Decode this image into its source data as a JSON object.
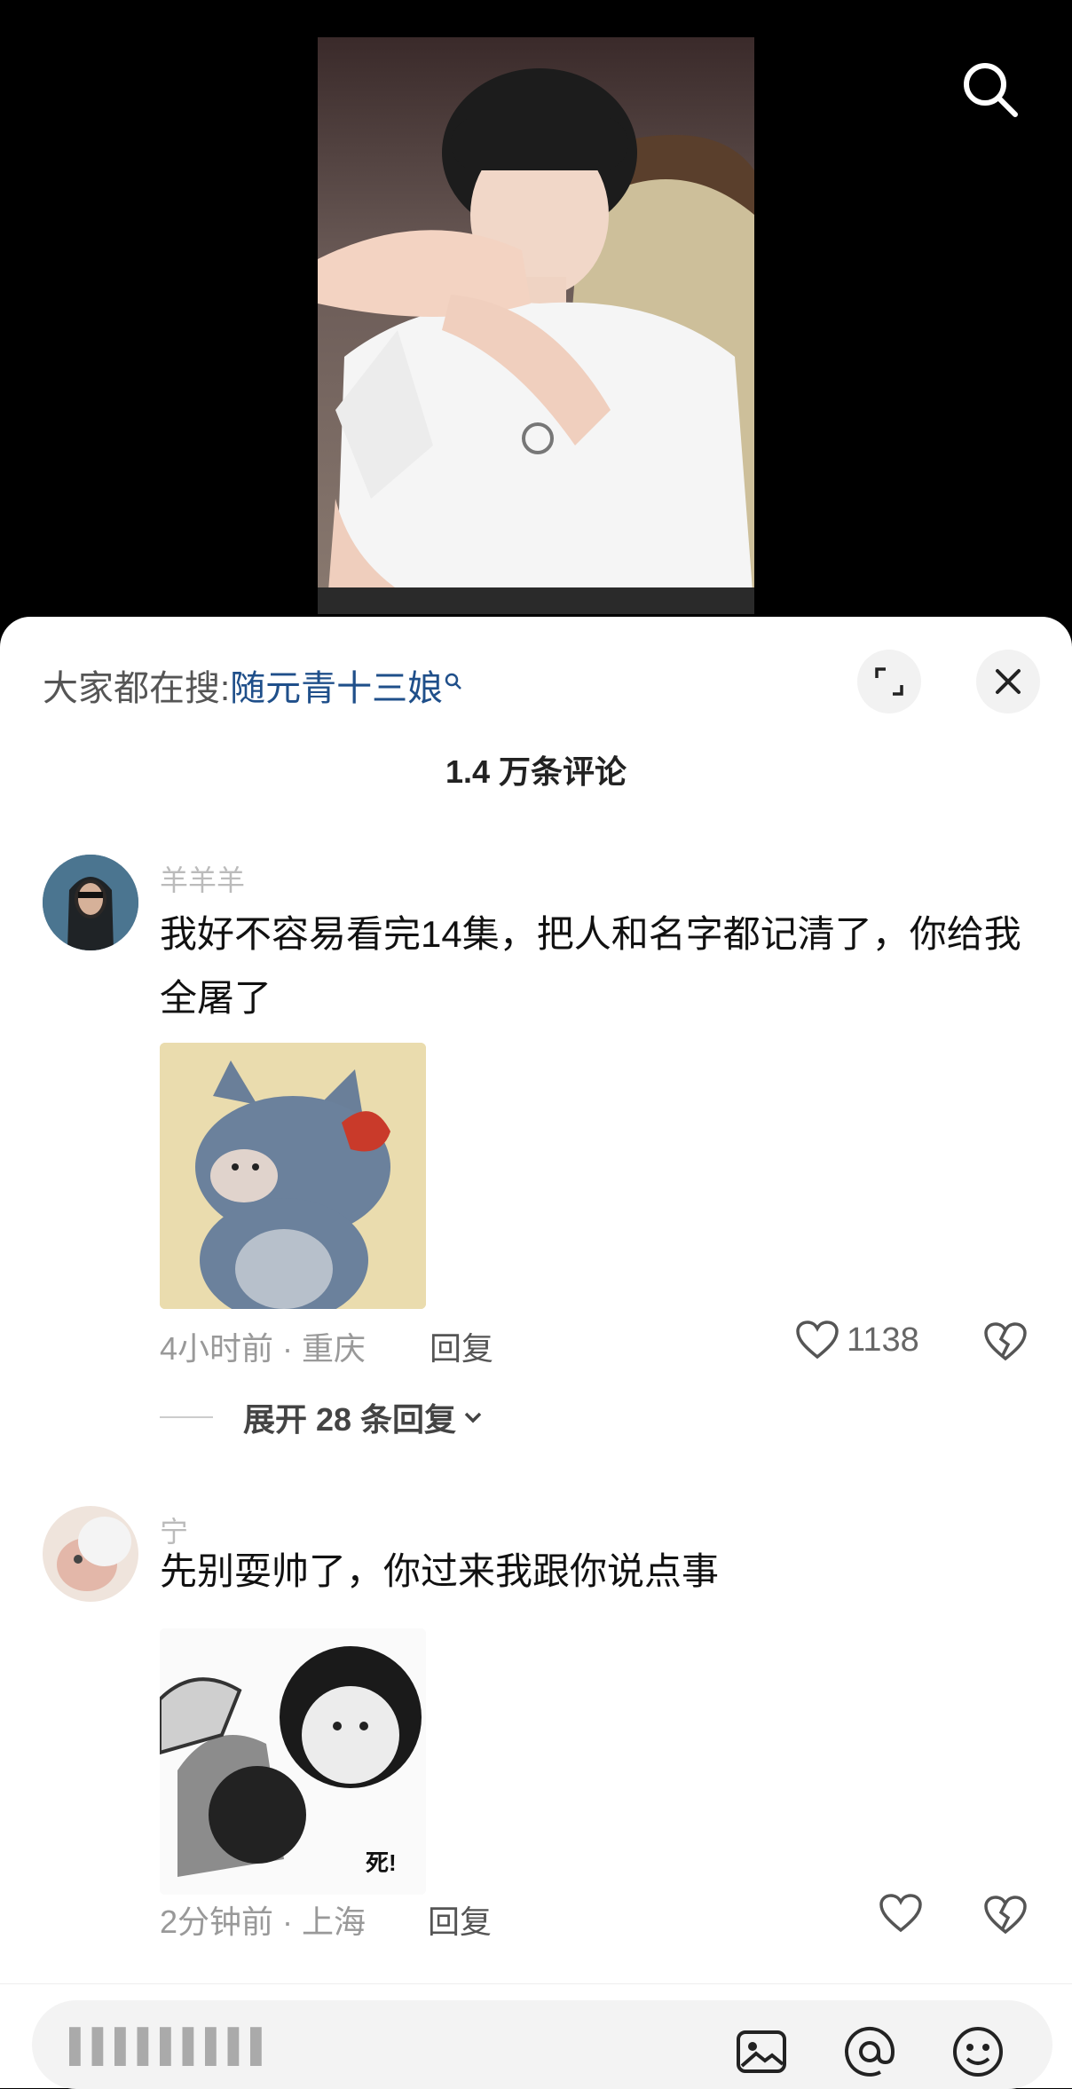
{
  "sheet": {
    "trending_label": "大家都在搜:",
    "trending_keyword": "随元青十三娘",
    "comment_count": "1.4 万条评论"
  },
  "comments": [
    {
      "username": "羊羊羊",
      "text": "我好不容易看完14集，把人和名字都记清了，你给我全屠了",
      "meta": "4小时前 · 重庆",
      "reply_label": "回复",
      "likes": "1138",
      "expand_label": "展开 28 条回复"
    },
    {
      "username": "宁",
      "text": "先别耍帅了，你过来我跟你说点事",
      "sticker_caption": "死!",
      "meta": "2分钟前 · 上海",
      "reply_label": "回复",
      "likes": ""
    }
  ],
  "input": {
    "placeholder": "▌▌▌▌▌▌▌▌▌"
  },
  "icons": {
    "top_search": "search-icon",
    "expand": "expand-icon",
    "close": "close-icon",
    "like": "heart-icon",
    "dislike": "broken-heart-icon",
    "image": "image-icon",
    "mention": "at-icon",
    "emoji": "emoji-icon"
  },
  "colors": {
    "keyword": "#1f4f8a",
    "background": "#000000",
    "sheet": "#ffffff"
  }
}
